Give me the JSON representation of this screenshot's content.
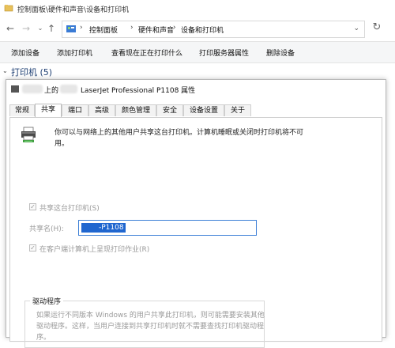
{
  "window": {
    "title": "控制面板\\硬件和声音\\设备和打印机"
  },
  "nav": {
    "breadcrumbs": [
      "控制面板",
      "硬件和声音",
      "设备和打印机"
    ]
  },
  "toolbar": {
    "items": [
      "添加设备",
      "添加打印机",
      "查看现在正在打印什么",
      "打印服务器属性",
      "删除设备"
    ]
  },
  "section": {
    "title": "打印机 (5)"
  },
  "dialog": {
    "title_prefix": "上的",
    "title_main": "LaserJet Professional P1108 属性",
    "tabs": [
      "常规",
      "共享",
      "端口",
      "高级",
      "颜色管理",
      "安全",
      "设备设置",
      "关于"
    ],
    "active_tab": "共享",
    "description": "你可以与网络上的其他用户共享这台打印机。计算机睡眠或关闭时打印机将不可用。",
    "share_checkbox_label": "共享这台打印机(S)",
    "share_checkbox_checked": true,
    "share_name_label": "共享名(H):",
    "share_name_value": "-P1108",
    "render_jobs_label": "在客户端计算机上呈现打印作业(R)",
    "render_jobs_checked": true,
    "drivers_group_title": "驱动程序",
    "drivers_text": "如果运行不同版本 Windows 的用户共享此打印机，则可能需要安装其他驱动程序。这样，当用户连接到共享打印机时就不需要查找打印机驱动程序。"
  },
  "colors": {
    "accent": "#1f66cf",
    "section_title": "#1e3f73"
  }
}
